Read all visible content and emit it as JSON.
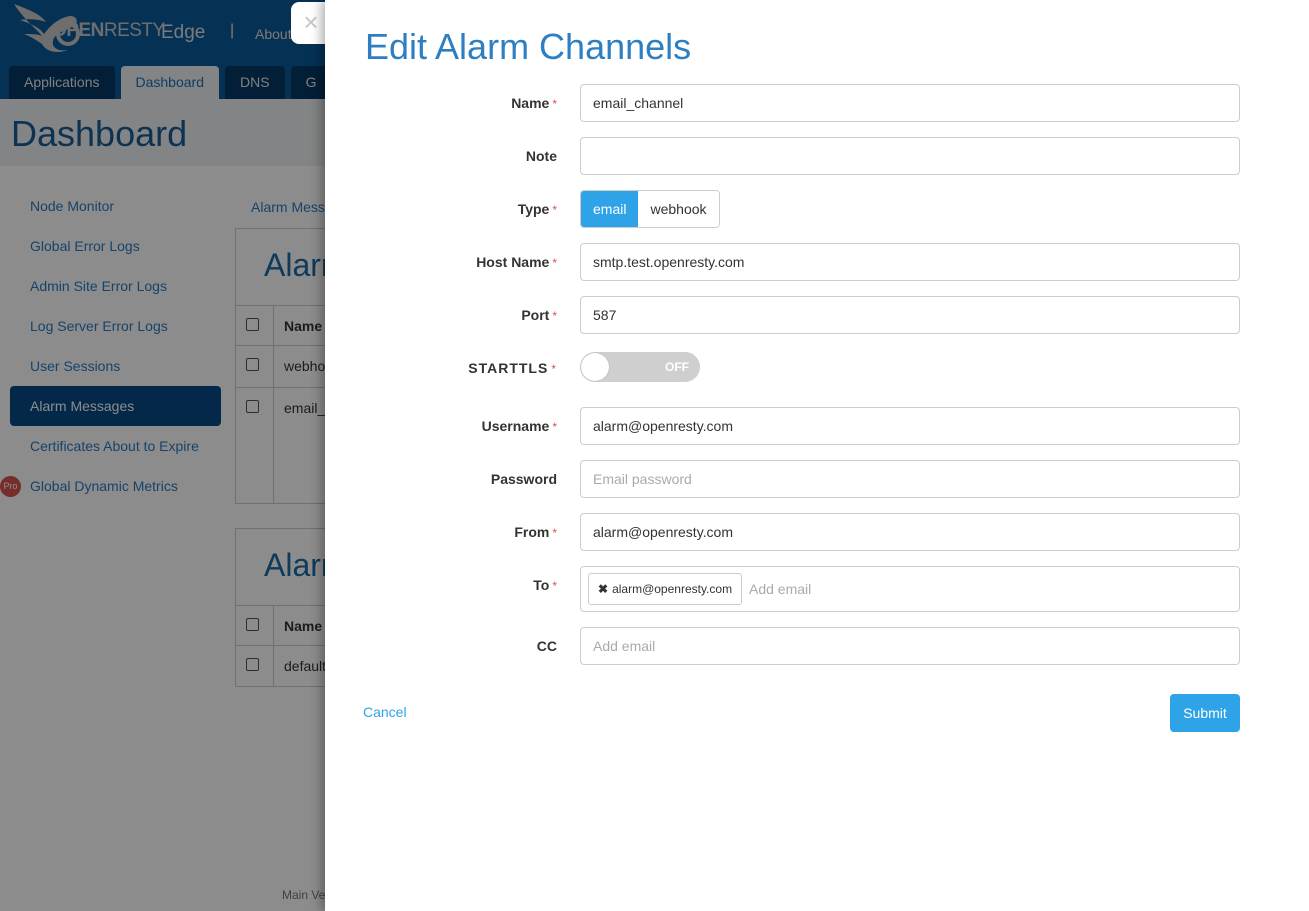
{
  "app": {
    "logo_text_bold": "OPEN",
    "logo_text_rest": "RESTY",
    "product": "Edge",
    "separator": "|",
    "about_link": "About"
  },
  "nav_tabs": [
    {
      "label": "Applications",
      "active": false
    },
    {
      "label": "Dashboard",
      "active": true
    },
    {
      "label": "DNS",
      "active": false
    },
    {
      "label": "G",
      "active": false
    }
  ],
  "page": {
    "title": "Dashboard",
    "breadcrumb": "Alarm Mess"
  },
  "sidebar": {
    "items": [
      {
        "label": "Node Monitor",
        "active": false
      },
      {
        "label": "Global Error Logs",
        "active": false
      },
      {
        "label": "Admin Site Error Logs",
        "active": false
      },
      {
        "label": "Log Server Error Logs",
        "active": false
      },
      {
        "label": "User Sessions",
        "active": false
      },
      {
        "label": "Alarm Messages",
        "active": true
      },
      {
        "label": "Certificates About to Expire",
        "active": false
      },
      {
        "label": "Global Dynamic Metrics",
        "active": false,
        "badge": "Pro"
      }
    ]
  },
  "background_panels": [
    {
      "title": "Alarm",
      "header": "Name",
      "rows": [
        "webho",
        "email_"
      ]
    },
    {
      "title": "Alarm",
      "header": "Name",
      "rows": [
        "default"
      ]
    }
  ],
  "footer": {
    "version_text": "Main Ve"
  },
  "drawer": {
    "close_icon": "×",
    "title": "Edit Alarm Channels",
    "fields": {
      "name": {
        "label": "Name",
        "required": "*",
        "value": ""
      },
      "note": {
        "label": "Note",
        "value": ""
      },
      "type": {
        "label": "Type",
        "required": "*",
        "options": [
          "email",
          "webhook"
        ],
        "selected": "email"
      },
      "host": {
        "label": "Host Name",
        "required": "*",
        "value": "smtp.test.openresty.com"
      },
      "port": {
        "label": "Port",
        "required": "*",
        "value": "587"
      },
      "starttls": {
        "label": "STARTTLS",
        "required": "*",
        "state": "OFF"
      },
      "username": {
        "label": "Username",
        "required": "*",
        "value": "alarm@openresty.com"
      },
      "password": {
        "label": "Password",
        "placeholder": "Email password",
        "value": ""
      },
      "from": {
        "label": "From",
        "required": "*",
        "value": "alarm@openresty.com"
      },
      "to": {
        "label": "To",
        "required": "*",
        "tags": [
          "alarm@openresty.com"
        ],
        "placeholder": "Add email"
      },
      "cc": {
        "label": "CC",
        "placeholder": "Add email"
      }
    },
    "name_value": "email_channel",
    "cancel_label": "Cancel",
    "submit_label": "Submit"
  },
  "colors": {
    "primary": "#2ea3e8",
    "header_bg": "#0a5a9c",
    "required": "#d9534f"
  }
}
